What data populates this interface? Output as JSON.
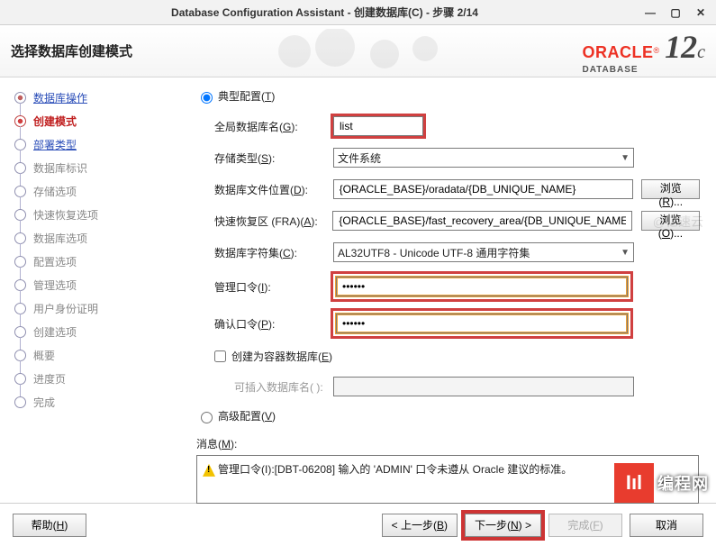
{
  "titlebar": {
    "title": "Database Configuration Assistant - 创建数据库(C) - 步骤 2/14"
  },
  "header": {
    "left_title": "选择数据库创建模式",
    "oracle": "ORACLE",
    "database": "DATABASE",
    "twelve": "12",
    "c": "c"
  },
  "sidebar": {
    "items": [
      {
        "label": "数据库操作",
        "state": "done",
        "link": true
      },
      {
        "label": "创建模式",
        "state": "current"
      },
      {
        "label": "部署类型",
        "state": "link",
        "link": true
      },
      {
        "label": "数据库标识",
        "state": "pending"
      },
      {
        "label": "存储选项",
        "state": "pending"
      },
      {
        "label": "快速恢复选项",
        "state": "pending"
      },
      {
        "label": "数据库选项",
        "state": "pending"
      },
      {
        "label": "配置选项",
        "state": "pending"
      },
      {
        "label": "管理选项",
        "state": "pending"
      },
      {
        "label": "用户身份证明",
        "state": "pending"
      },
      {
        "label": "创建选项",
        "state": "pending"
      },
      {
        "label": "概要",
        "state": "pending"
      },
      {
        "label": "进度页",
        "state": "pending"
      },
      {
        "label": "完成",
        "state": "pending"
      }
    ]
  },
  "main": {
    "radio_typical": "典型配置(",
    "radio_typical_accel": "T",
    "radio_advanced": "高级配置(",
    "radio_advanced_accel": "V",
    "close_paren": ")",
    "fields": {
      "global_db_label": "全局数据库名(",
      "global_db_accel": "G",
      "global_db_value": "list",
      "storage_label": "存储类型(",
      "storage_accel": "S",
      "storage_value": "文件系统",
      "dbfile_label": "数据库文件位置(",
      "dbfile_accel": "D",
      "dbfile_value": "{ORACLE_BASE}/oradata/{DB_UNIQUE_NAME}",
      "fra_label": "快速恢复区 (FRA)(",
      "fra_accel": "A",
      "fra_value": "{ORACLE_BASE}/fast_recovery_area/{DB_UNIQUE_NAME}",
      "charset_label": "数据库字符集(",
      "charset_accel": "C",
      "charset_value": "AL32UTF8 - Unicode UTF-8 通用字符集",
      "admin_pw_label": "管理口令(",
      "admin_pw_accel": "I",
      "admin_pw_value": "••••••",
      "confirm_pw_label": "确认口令(",
      "confirm_pw_accel": "P",
      "confirm_pw_value": "••••••",
      "cdb_checkbox": "创建为容器数据库(",
      "cdb_accel": "E",
      "pdb_label": "可插入数据库名(",
      "pdb_accel": "",
      "browse_r": "浏览(",
      "browse_r_accel": "R",
      "browse_r_close": ")...",
      "browse_o": "浏览(",
      "browse_o_accel": "O",
      "browse_o_close": ")..."
    },
    "msg_label": "消息(",
    "msg_accel": "M",
    "msg_close": "):",
    "msg_text": "管理口令(I):[DBT-06208] 输入的 'ADMIN' 口令未遵从 Oracle 建议的标准。"
  },
  "footer": {
    "help": "帮助(",
    "help_accel": "H",
    "back": "< 上一步(",
    "back_accel": "B",
    "next": "下一步(",
    "next_accel": "N",
    "next_suffix": ") >",
    "finish": "完成(",
    "finish_accel": "F",
    "cancel": "取消"
  },
  "watermark": {
    "logo": "Iıl",
    "text": "编程网"
  },
  "ghost": "@亿速云"
}
